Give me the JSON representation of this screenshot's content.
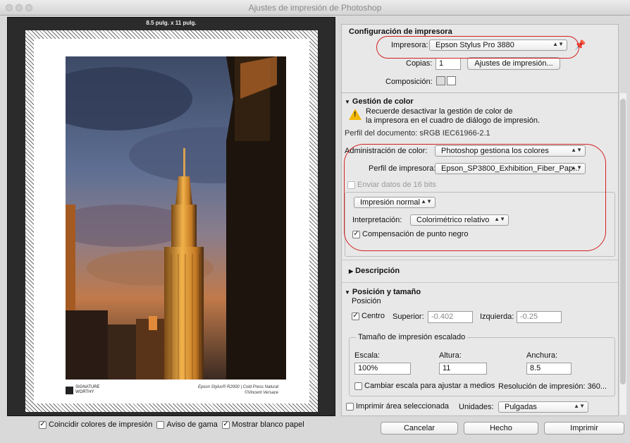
{
  "window": {
    "title": "Ajustes de impresión de Photoshop"
  },
  "preview": {
    "size_label": "8.5 pulg. x 11 pulg.",
    "signature_line1": "SIGNATURE",
    "signature_line2": "WORTHY",
    "caption_line1": "Epson Stylus® R2000 | Cold Press Natural",
    "caption_line2": "©Vincent Versace"
  },
  "bottom_left": {
    "match_colors": "Coincidir colores de impresión",
    "gamut_warning": "Aviso de gama",
    "show_paper_white": "Mostrar blanco papel"
  },
  "printer_setup": {
    "header": "Configuración de impresora",
    "printer_label": "Impresora:",
    "printer_value": "Epson Stylus Pro 3880",
    "copies_label": "Copias:",
    "copies_value": "1",
    "print_settings_button": "Ajustes de impresión...",
    "layout_label": "Composición:"
  },
  "color_management": {
    "header": "Gestión de color",
    "warning_line1": "Recuerde desactivar la gestión de color de",
    "warning_line2": "la impresora en el cuadro de diálogo de impresión.",
    "document_profile": "Perfil del documento: sRGB IEC61966-2.1",
    "color_handling_label": "Administración de color:",
    "color_handling_value": "Photoshop gestiona los colores",
    "printer_profile_label": "Perfil de impresora:",
    "printer_profile_value": "Epson_SP3800_Exhibition_Fiber_Pap...",
    "send_16bit": "Enviar datos de 16 bits",
    "print_mode_value": "Impresión normal",
    "rendering_label": "Interpretación:",
    "rendering_value": "Colorimétrico relativo",
    "black_point": "Compensación de punto negro"
  },
  "description": {
    "header": "Descripción"
  },
  "position_size": {
    "header": "Posición y tamaño",
    "position_group": "Posición",
    "center_label": "Centro",
    "top_label": "Superior:",
    "top_value": "-0.402",
    "left_label": "Izquierda:",
    "left_value": "-0.25",
    "scaled_group": "Tamaño de impresión escalado",
    "scale_label": "Escala:",
    "scale_value": "100%",
    "height_label": "Altura:",
    "height_value": "11",
    "width_label": "Anchura:",
    "width_value": "8.5",
    "scale_to_fit": "Cambiar escala para ajustar a medios",
    "resolution": "Resolución de impresión: 360...",
    "print_selected": "Imprimir área seleccionada",
    "units_label": "Unidades:",
    "units_value": "Pulgadas"
  },
  "footer": {
    "cancel": "Cancelar",
    "done": "Hecho",
    "print": "Imprimir"
  },
  "colors": {
    "highlight_ring": "#d42020",
    "warning": "#f2b705"
  },
  "icons": [
    "close-dot-icon",
    "minimize-dot-icon",
    "zoom-dot-icon",
    "chevron-updown-icon",
    "pin-icon",
    "portrait-layout-icon",
    "landscape-layout-icon",
    "warning-icon",
    "disclosure-triangle-icon",
    "checkmark-icon"
  ]
}
